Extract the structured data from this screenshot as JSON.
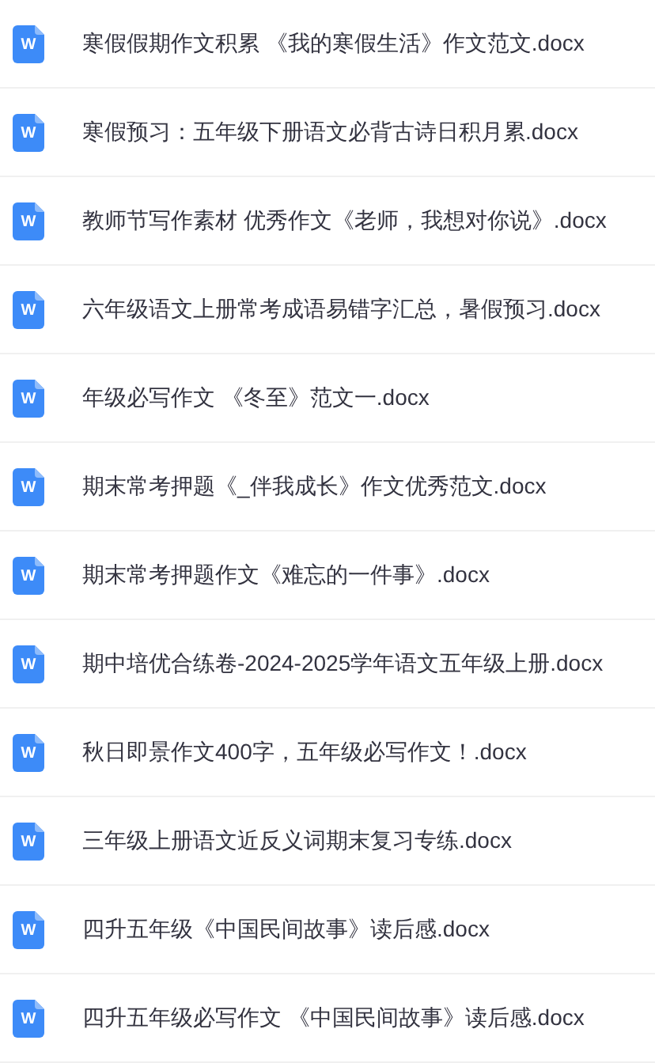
{
  "files": [
    {
      "icon_label": "W",
      "name": "寒假假期作文积累 《我的寒假生活》作文范文.docx"
    },
    {
      "icon_label": "W",
      "name": "寒假预习：五年级下册语文必背古诗日积月累.docx"
    },
    {
      "icon_label": "W",
      "name": "教师节写作素材 优秀作文《老师，我想对你说》.docx"
    },
    {
      "icon_label": "W",
      "name": "六年级语文上册常考成语易错字汇总，暑假预习.docx"
    },
    {
      "icon_label": "W",
      "name": "年级必写作文 《冬至》范文一.docx"
    },
    {
      "icon_label": "W",
      "name": "期末常考押题《_伴我成长》作文优秀范文.docx"
    },
    {
      "icon_label": "W",
      "name": "期末常考押题作文《难忘的一件事》.docx"
    },
    {
      "icon_label": "W",
      "name": "期中培优合练卷-2024-2025学年语文五年级上册.docx"
    },
    {
      "icon_label": "W",
      "name": "秋日即景作文400字，五年级必写作文！.docx"
    },
    {
      "icon_label": "W",
      "name": "三年级上册语文近反义词期末复习专练.docx"
    },
    {
      "icon_label": "W",
      "name": "四升五年级《中国民间故事》读后感.docx"
    },
    {
      "icon_label": "W",
      "name": "四升五年级必写作文 《中国民间故事》读后感.docx"
    }
  ]
}
